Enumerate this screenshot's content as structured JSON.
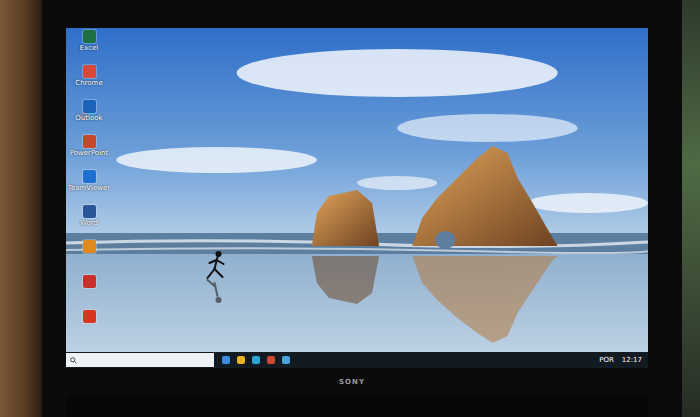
{
  "monitor": {
    "brand": "SONY"
  },
  "desktop": {
    "icons": [
      {
        "label": "Excel",
        "color": "#1d7044"
      },
      {
        "label": "Chrome",
        "color": "#d9483b"
      },
      {
        "label": "Outlook",
        "color": "#1b63b8"
      },
      {
        "label": "PowerPoint",
        "color": "#c8472a"
      },
      {
        "label": "TeamViewer",
        "color": "#1f6fd1"
      },
      {
        "label": "Word",
        "color": "#2a5699"
      },
      {
        "color": "#e08a1e"
      },
      {
        "color": "#c9302c"
      },
      {
        "color": "#d9341f"
      }
    ]
  },
  "taskbar": {
    "pinned": [
      {
        "color": "#3a8de0"
      },
      {
        "color": "#e6b422"
      },
      {
        "color": "#2fa4d8"
      },
      {
        "color": "#d04a3a"
      },
      {
        "color": "#4aa3df"
      }
    ],
    "tray": {
      "language": "POR",
      "time": "12:17"
    }
  }
}
